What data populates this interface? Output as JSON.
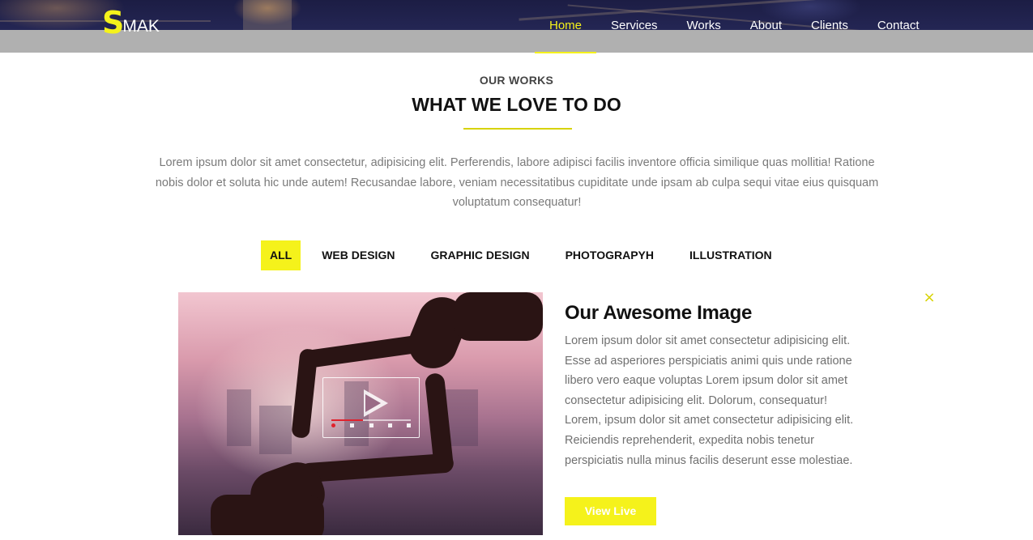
{
  "header": {
    "logo_initial": "S",
    "logo_rest": "MAK",
    "nav": [
      {
        "label": "Home",
        "active": true
      },
      {
        "label": "Services",
        "active": false
      },
      {
        "label": "Works",
        "active": false
      },
      {
        "label": "About",
        "active": false
      },
      {
        "label": "Clients",
        "active": false
      },
      {
        "label": "Contact",
        "active": false
      }
    ]
  },
  "section": {
    "eyebrow": "OUR WORKS",
    "title": "WHAT WE LOVE TO DO",
    "intro": "Lorem ipsum dolor sit amet consectetur, adipisicing elit. Perferendis, labore adipisci facilis inventore officia similique quas mollitia! Ratione nobis dolor et soluta hic unde autem! Recusandae labore, veniam necessitatibus cupiditate unde ipsam ab culpa sequi vitae eius quisquam voluptatum consequatur!"
  },
  "filters": [
    {
      "label": "ALL",
      "active": true
    },
    {
      "label": "WEB DESIGN",
      "active": false
    },
    {
      "label": "GRAPHIC DESIGN",
      "active": false
    },
    {
      "label": "PHOTOGRAPYH",
      "active": false
    },
    {
      "label": "ILLUSTRATION",
      "active": false
    }
  ],
  "work": {
    "title": "Our Awesome Image",
    "description": "Lorem ipsum dolor sit amet consectetur adipisicing elit. Esse ad asperiores perspiciatis animi quis unde ratione libero vero eaque voluptas Lorem ipsum dolor sit amet consectetur adipisicing elit. Dolorum, consequatur! Lorem, ipsum dolor sit amet consectetur adipisicing elit. Reiciendis reprehenderit, expedita nobis tenetur perspiciatis nulla minus facilis deserunt esse molestiae.",
    "button_label": "View Live",
    "close_symbol": "×",
    "image_icon": "video-frame-hands-icon",
    "video_progress": 0.4
  },
  "colors": {
    "accent": "#f5f21b",
    "accent_dark": "#d7d300",
    "header_band": "#b0b0b0",
    "text_muted": "#7a7a7a"
  }
}
